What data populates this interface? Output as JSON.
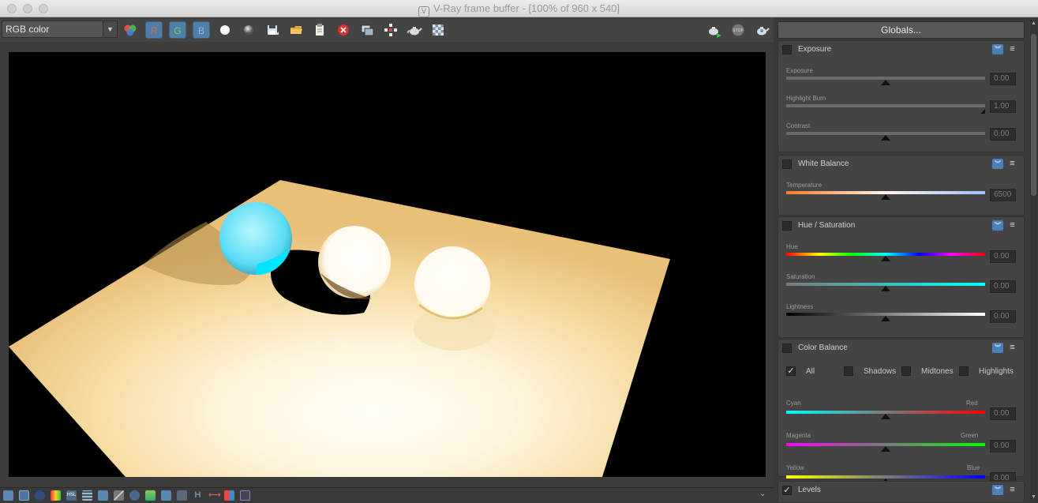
{
  "window": {
    "title": "V-Ray frame buffer - [100% of 960 x 540]"
  },
  "toolbar": {
    "channel": "RGB color",
    "r_label": "R",
    "g_label": "G",
    "b_label": "B"
  },
  "panel": {
    "globals_label": "Globals...",
    "exposure": {
      "title": "Exposure",
      "exposure_label": "Exposure",
      "exposure_value": "0.00",
      "highlight_burn_label": "Highlight Burn",
      "highlight_burn_value": "1.00",
      "contrast_label": "Contrast",
      "contrast_value": "0.00"
    },
    "white_balance": {
      "title": "White Balance",
      "temperature_label": "Temperature",
      "temperature_value": "6500"
    },
    "hue_saturation": {
      "title": "Hue / Saturation",
      "hue_label": "Hue",
      "hue_value": "0.00",
      "saturation_label": "Saturation",
      "saturation_value": "0.00",
      "lightness_label": "Lightness",
      "lightness_value": "0.00"
    },
    "color_balance": {
      "title": "Color Balance",
      "all_label": "All",
      "shadows_label": "Shadows",
      "midtones_label": "Midtones",
      "highlights_label": "Highlights",
      "cyan_label": "Cyan",
      "red_label": "Red",
      "cyan_red_value": "0.00",
      "magenta_label": "Magenta",
      "green_label": "Green",
      "magenta_green_value": "0.00",
      "yellow_label": "Yellow",
      "blue_label": "Blue",
      "yellow_blue_value": "0.00"
    },
    "levels": {
      "title": "Levels"
    }
  },
  "colors": {
    "accent": "#4f7fa6",
    "floor": "#f5d596",
    "sphere_cyan": "#34e6ff"
  }
}
